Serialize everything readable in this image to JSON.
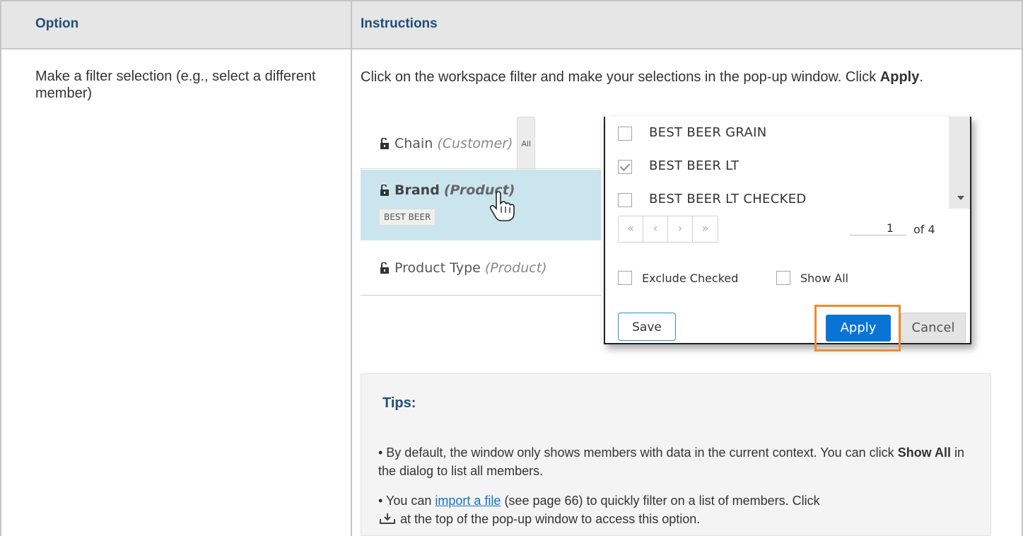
{
  "table": {
    "header": {
      "option": "Option",
      "instructions": "Instructions"
    },
    "row": {
      "option_text": "Make a filter selection (e.g., select a different member)",
      "instr_pre": "Click on the workspace filter and make your selections in the pop-up window. Click ",
      "instr_bold": "Apply",
      "instr_post": "."
    }
  },
  "screenshot": {
    "filters": [
      {
        "name": "Chain",
        "dim": "(Customer)",
        "badge": "All"
      },
      {
        "name": "Brand",
        "dim": "(Product)",
        "badge": "BEST BEER",
        "selected": true
      },
      {
        "name": "Product Type",
        "dim": "(Product)"
      }
    ],
    "popup": {
      "items": [
        {
          "label": "BEST BEER GRAIN",
          "checked": false
        },
        {
          "label": "BEST BEER LT",
          "checked": true
        },
        {
          "label": "BEST BEER LT CHECKED",
          "checked": false
        }
      ],
      "pager": {
        "first": "«",
        "prev": "‹",
        "next": "›",
        "last": "»",
        "page": "1",
        "of": "of 4"
      },
      "exclude_checked": "Exclude Checked",
      "show_all": "Show All",
      "save": "Save",
      "apply": "Apply",
      "cancel": "Cancel"
    }
  },
  "tips": {
    "title": "Tips:",
    "tip1_pre": "• By default, the window only shows members with data in the current context. You can click ",
    "tip1_bold": "Show All",
    "tip1_post": " in the dialog to list all members.",
    "tip2_pre": "• You can ",
    "tip2_link": "import a file",
    "tip2_mid": " (see page 66) to quickly filter on a list of members. Click",
    "tip2_post": " at the top of the pop-up window to access this option.",
    "icon": "download-icon"
  },
  "colors": {
    "heading": "#1f4e79",
    "selected_row": "#cbe5ee",
    "apply_button": "#0a74d4",
    "highlight": "#f08c30",
    "link": "#1a73c7"
  }
}
